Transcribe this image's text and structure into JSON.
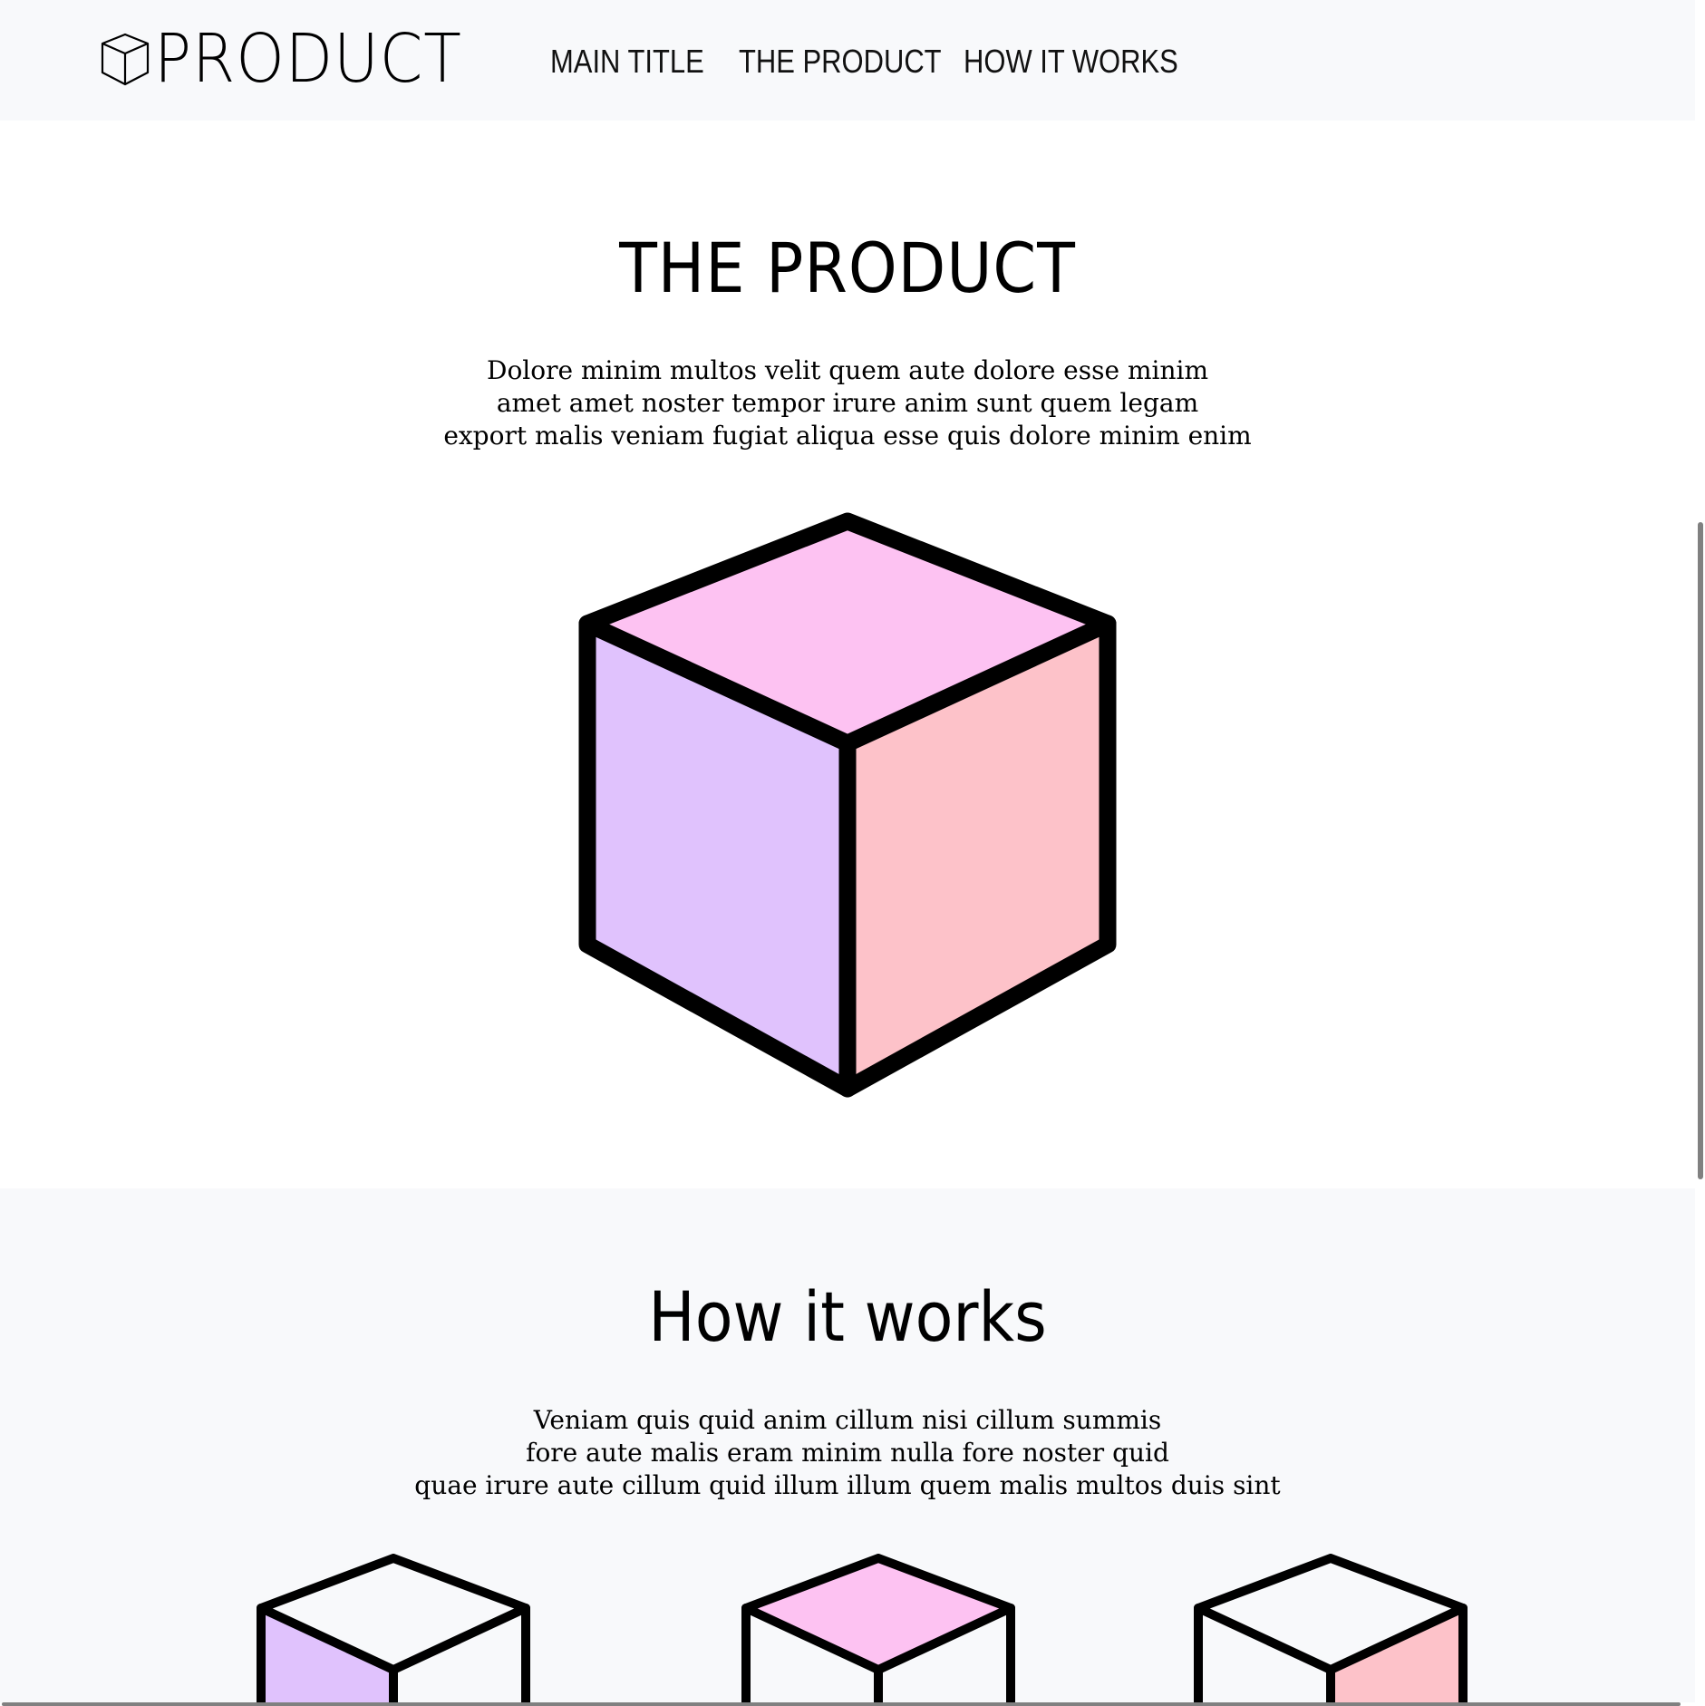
{
  "brand": {
    "icon": "cube-outline-icon",
    "name": "PRODUCT"
  },
  "nav": {
    "items": [
      {
        "label": "MAIN TITLE"
      },
      {
        "label": "THE PRODUCT"
      },
      {
        "label": "HOW IT WORKS"
      }
    ]
  },
  "product_section": {
    "title": "THE PRODUCT",
    "text_lines": [
      "Dolore minim multos velit quem aute dolore esse minim",
      "amet amet noster tempor irure anim sunt quem legam",
      "export malis veniam fugiat aliqua esse quis dolore minim enim"
    ],
    "illustration": "cube-icon"
  },
  "how_section": {
    "title": "How it works",
    "text_lines": [
      "Veniam quis quid anim cillum nisi cillum summis",
      "fore aute malis eram minim nulla fore noster quid",
      "quae irure aute cillum quid illum illum quem malis multos duis sint"
    ],
    "steps": [
      {
        "icon": "cube-left-face-icon"
      },
      {
        "icon": "cube-top-face-icon"
      },
      {
        "icon": "cube-right-face-icon"
      }
    ]
  },
  "colors": {
    "header_bg": "#f8f9fb",
    "section_alt_bg": "#f8f9fb",
    "cube_top": "#fdc2f2",
    "cube_left": "#e0c2fd",
    "cube_right": "#fdc2c9",
    "cube_stroke": "#000000",
    "scrollbar": "#808080"
  }
}
